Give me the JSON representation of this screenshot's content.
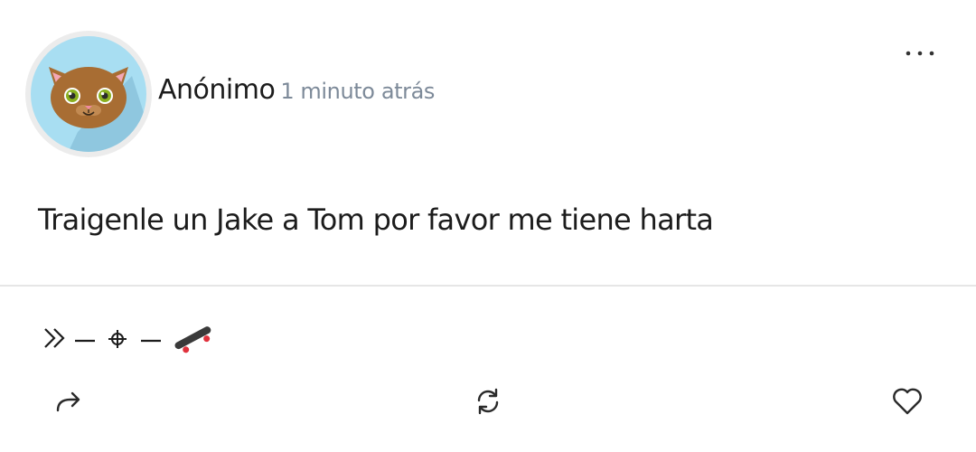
{
  "post": {
    "author": "Anónimo",
    "timestamp": "1 minuto atrás",
    "body": "Traigenle un Jake a Tom por favor me tiene harta",
    "signature_icons": [
      "double-chevron-right-icon",
      "dash-icon",
      "crosshair-icon",
      "dash-icon",
      "skateboard-icon"
    ]
  },
  "avatar": {
    "icon": "cat-face-icon",
    "background_color": "#a8def2"
  },
  "actions": {
    "more": "more-options-icon",
    "share": "share-arrow-icon",
    "refresh": "refresh-icon",
    "like": "heart-icon"
  }
}
